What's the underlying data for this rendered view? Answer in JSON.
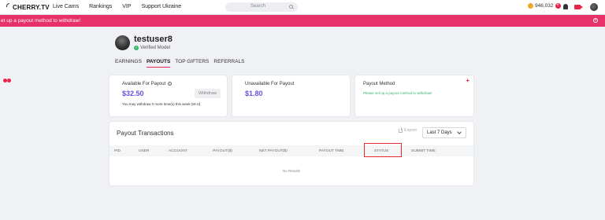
{
  "header": {
    "brand": "CHERRY.TV",
    "nav": [
      "Live Cams",
      "Rankings",
      "VIP",
      "Support Ukraine"
    ],
    "search_placeholder": "Search",
    "coins": "946,032",
    "colors": {
      "accent": "#e8244a",
      "alert_bg": "#e8306a",
      "amount": "#6b4ee0",
      "success": "#35b66a"
    }
  },
  "alert": {
    "text": "et up a payout method to withdraw!"
  },
  "profile": {
    "username": "testuser8",
    "badge": "Verified Model"
  },
  "tabs": [
    {
      "label": "EARNINGS",
      "active": false
    },
    {
      "label": "PAYOUTS",
      "active": true
    },
    {
      "label": "TOP GIFTERS",
      "active": false
    },
    {
      "label": "REFERRALS",
      "active": false
    }
  ],
  "cards": {
    "available": {
      "label": "Available For Payout",
      "amount": "$32.50",
      "button": "Withdraw",
      "note": "You may withdraw 0 more time(s) this week (M-U)"
    },
    "unavailable": {
      "label": "Unavailable For Payout",
      "amount": "$1.80"
    },
    "method": {
      "label": "Payout Method",
      "note": "Please set up a payout method to withdraw!",
      "add": "+"
    }
  },
  "transactions": {
    "title": "Payout Transactions",
    "export": "Export",
    "range": "Last 7 Days",
    "columns": [
      "PID",
      "USER",
      "ACCOUNT",
      "PAYOUT($)",
      "NET PAYOUT($)",
      "PAYOUT TIME",
      "STATUS",
      "SUBMIT TIME"
    ],
    "empty": "No Results"
  }
}
